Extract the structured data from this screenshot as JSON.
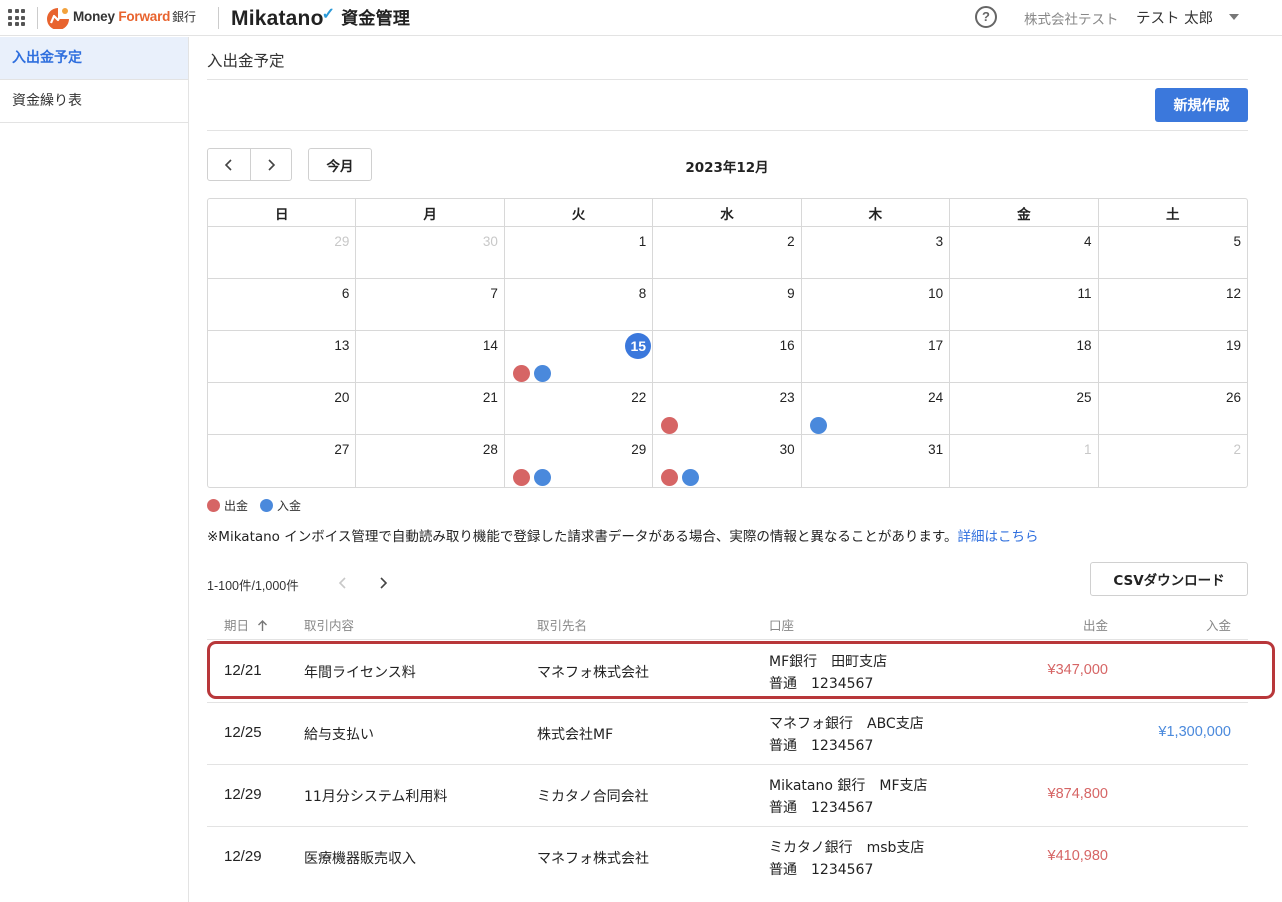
{
  "header": {
    "brand_mf": "Money ",
    "brand_fw": "Forward",
    "brand_bank": "銀行",
    "brand_mikatano": "Mikatano",
    "brand_tick": "✓",
    "brand_product": "資金管理",
    "help": "?",
    "company": "株式会社テスト",
    "user": "テスト 太郎",
    "accent_color": "#3b78dc"
  },
  "sidebar": {
    "items": [
      {
        "label": "入出金予定",
        "active": true
      },
      {
        "label": "資金繰り表",
        "active": false
      }
    ]
  },
  "main": {
    "title": "入出金予定",
    "new_button": "新規作成",
    "today_button": "今月",
    "month": "2023年12月"
  },
  "calendar": {
    "weekdays": [
      "日",
      "月",
      "火",
      "水",
      "木",
      "金",
      "土"
    ],
    "weeks": [
      [
        {
          "d": "29",
          "muted": true
        },
        {
          "d": "30",
          "muted": true
        },
        {
          "d": "1"
        },
        {
          "d": "2"
        },
        {
          "d": "3"
        },
        {
          "d": "4"
        },
        {
          "d": "5"
        }
      ],
      [
        {
          "d": "6"
        },
        {
          "d": "7"
        },
        {
          "d": "8"
        },
        {
          "d": "9"
        },
        {
          "d": "10"
        },
        {
          "d": "11"
        },
        {
          "d": "12"
        }
      ],
      [
        {
          "d": "13"
        },
        {
          "d": "14"
        },
        {
          "d": "15",
          "today": true,
          "dots": [
            "out",
            "in"
          ]
        },
        {
          "d": "16"
        },
        {
          "d": "17"
        },
        {
          "d": "18"
        },
        {
          "d": "19"
        }
      ],
      [
        {
          "d": "20"
        },
        {
          "d": "21"
        },
        {
          "d": "22"
        },
        {
          "d": "23",
          "dots": [
            "out"
          ]
        },
        {
          "d": "24",
          "dots": [
            "in"
          ]
        },
        {
          "d": "25"
        },
        {
          "d": "26"
        }
      ],
      [
        {
          "d": "27"
        },
        {
          "d": "28"
        },
        {
          "d": "29",
          "dots": [
            "out",
            "in"
          ]
        },
        {
          "d": "30",
          "dots": [
            "out",
            "in"
          ]
        },
        {
          "d": "31"
        },
        {
          "d": "1",
          "muted": true
        },
        {
          "d": "2",
          "muted": true
        }
      ]
    ],
    "out_color": "#d66565",
    "in_color": "#4a89dc"
  },
  "legend": {
    "out": "出金",
    "in": "入金"
  },
  "notice": {
    "text": "※Mikatano インボイス管理で自動読み取り機能で登録した請求書データがある場合、実際の情報と異なることがあります。",
    "link": "詳細はこちら"
  },
  "list": {
    "count": "1-100件/1,000件",
    "csv_button": "CSVダウンロード",
    "columns": {
      "date": "期日",
      "desc": "取引内容",
      "partner": "取引先名",
      "account": "口座",
      "out": "出金",
      "in": "入金"
    },
    "rows": [
      {
        "date": "12/21",
        "desc": "年間ライセンス料",
        "partner": "マネフォ株式会社",
        "account1": "MF銀行　田町支店",
        "account2": "普通　1234567",
        "out": "¥347,000",
        "in": ""
      },
      {
        "date": "12/25",
        "desc": "給与支払い",
        "partner": "株式会社MF",
        "account1": "マネフォ銀行　ABC支店",
        "account2": "普通　1234567",
        "out": "",
        "in": "¥1,300,000"
      },
      {
        "date": "12/29",
        "desc": "11月分システム利用料",
        "partner": "ミカタノ合同会社",
        "account1": "Mikatano 銀行　MF支店",
        "account2": "普通　1234567",
        "out": "¥874,800",
        "in": ""
      },
      {
        "date": "12/29",
        "desc": "医療機器販売収入",
        "partner": "マネフォ株式会社",
        "account1": "ミカタノ銀行　msb支店",
        "account2": "普通　1234567",
        "out": "¥410,980",
        "in": ""
      }
    ]
  }
}
